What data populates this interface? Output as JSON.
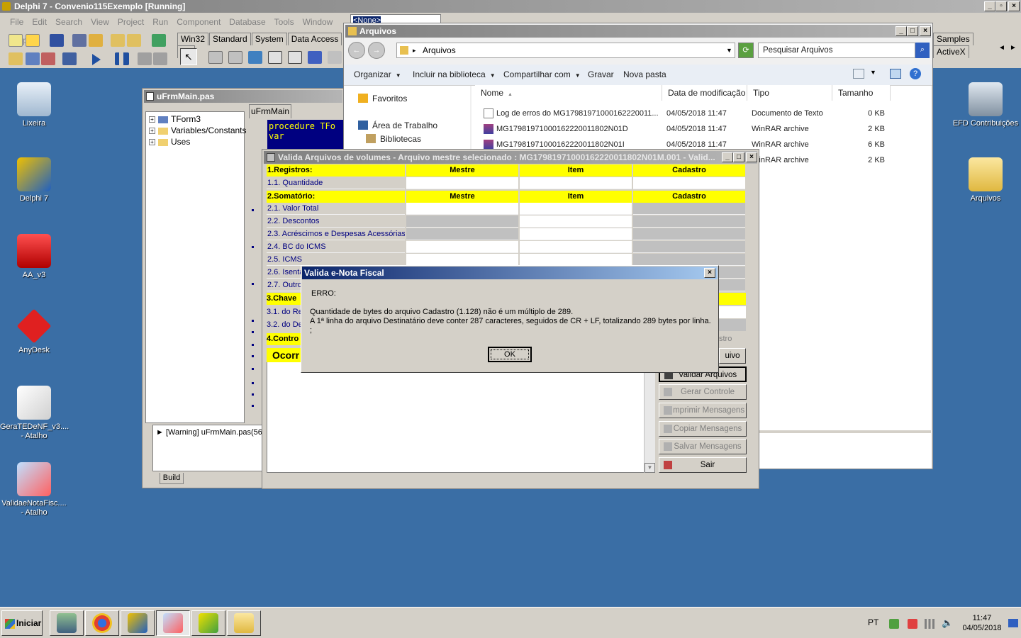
{
  "ide": {
    "title": "Delphi 7 - Convenio115Exemplo [Running]",
    "menu": [
      "File",
      "Edit",
      "Search",
      "View",
      "Project",
      "Run",
      "Component",
      "Database",
      "Tools",
      "Window",
      "Help"
    ],
    "combo_value": "<None>",
    "palette_tabs": [
      "Win32",
      "Standard",
      "System",
      "Data Access",
      "Da"
    ],
    "palette_tabs_right": [
      "Samples",
      "ActiveX"
    ]
  },
  "desktop": {
    "icons_left": [
      {
        "label": "Lixeira",
        "icon": "recycle-bin-icon"
      },
      {
        "label": "Delphi 7",
        "icon": "delphi-icon"
      },
      {
        "label": "AA_v3",
        "icon": "autocad-icon"
      },
      {
        "label": "AnyDesk",
        "icon": "anydesk-icon"
      },
      {
        "label": "GeraTEDeNF_v3....",
        "label2": "- Atalho",
        "icon": "disc-document-icon"
      },
      {
        "label": "ValidaeNotaFisc....",
        "label2": "- Atalho",
        "icon": "magnifier-disc-icon"
      }
    ],
    "icons_right": [
      {
        "label": "EFD Contribuições",
        "icon": "sped-icon"
      },
      {
        "label": "Arquivos",
        "icon": "folder-icon"
      }
    ]
  },
  "editor": {
    "title": "uFrmMain.pas",
    "tab": "uFrmMain",
    "tree": [
      "TForm3",
      "Variables/Constants",
      "Uses"
    ],
    "code_lines": [
      "procedure TFo",
      "var"
    ],
    "message": "[Warning] uFrmMain.pas(56",
    "build_tab": "Build"
  },
  "explorer": {
    "title": "Arquivos",
    "address": "Arquivos",
    "search_placeholder": "Pesquisar Arquivos",
    "toolbar": [
      "Organizar",
      "Incluir na biblioteca",
      "Compartilhar com",
      "Gravar",
      "Nova pasta"
    ],
    "nav": [
      "Favoritos",
      "Área de Trabalho",
      "Bibliotecas"
    ],
    "columns": [
      "Nome",
      "Data de modificação",
      "Tipo",
      "Tamanho"
    ],
    "files": [
      {
        "name": "Log de erros do MG17981971000162220011...",
        "date": "04/05/2018 11:47",
        "type": "Documento de Texto",
        "size": "0 KB",
        "icon": "text-file-icon"
      },
      {
        "name": "MG17981971000162220011802N01D",
        "date": "04/05/2018 11:47",
        "type": "WinRAR archive",
        "size": "2 KB",
        "icon": "winrar-icon"
      },
      {
        "name": "MG17981971000162220011802N01I",
        "date": "04/05/2018 11:47",
        "type": "WinRAR archive",
        "size": "6 KB",
        "icon": "winrar-icon"
      },
      {
        "name": "",
        "date": "",
        "type": "WinRAR archive",
        "size": "2 KB",
        "icon": "winrar-icon"
      }
    ]
  },
  "valida": {
    "title": "Valida Arquivos de volumes - Arquivo mestre selecionado : MG17981971000162220011802N01M.001 - Valid...",
    "col_headers": [
      "Mestre",
      "Item",
      "Cadastro"
    ],
    "sections": [
      {
        "label": "1.Registros:"
      },
      {
        "label": "2.Somatório:"
      }
    ],
    "rows_registros": [
      "1.1. Quantidade"
    ],
    "rows_somatorio": [
      "2.1. Valor Total",
      "2.2. Descontos",
      "2.3. Acréscimos e Despesas Acessórias",
      "2.4. BC do ICMS",
      "2.5. ICMS",
      "2.6. Isenta",
      "2.7. Outro"
    ],
    "chave": "3.Chave",
    "chave_rows": [
      "3.1. do Re",
      "3.2. do De"
    ],
    "controle": "4.Contro",
    "ocorr": "Ocorr",
    "stro": "stro",
    "buttons": [
      {
        "label": "uivo",
        "enabled": true
      },
      {
        "label": "Validar Arquivos",
        "enabled": true
      },
      {
        "label": "Gerar Controle",
        "enabled": false
      },
      {
        "label": "Imprimir Mensagens",
        "enabled": false
      },
      {
        "label": "Copiar Mensagens",
        "enabled": false
      },
      {
        "label": "Salvar Mensagens",
        "enabled": false
      },
      {
        "label": "Sair",
        "enabled": true
      }
    ]
  },
  "dialog": {
    "title": "Valida e-Nota Fiscal",
    "line1": "ERRO:",
    "line2": "Quantidade de bytes do arquivo Cadastro (1.128) não é um múltiplo de 289.",
    "line3": "A 1ª linha do arquivo Destinatário deve conter 287 caracteres, seguidos de CR + LF, totalizando 289 bytes por linha.",
    "line4": ";",
    "ok": "OK"
  },
  "taskbar": {
    "start": "Iniciar",
    "lang": "PT",
    "time": "11:47",
    "date": "04/05/2018",
    "apps": [
      "app-network-icon",
      "chrome-icon",
      "delphi-icon",
      "magnifier-disc-icon",
      "delphi7-icon",
      "folder-icon"
    ]
  },
  "colors": {
    "desktop": "#3a6ea5",
    "yellow": "#ffff00",
    "title_active": "#0a246a",
    "navy_text": "#000080"
  }
}
